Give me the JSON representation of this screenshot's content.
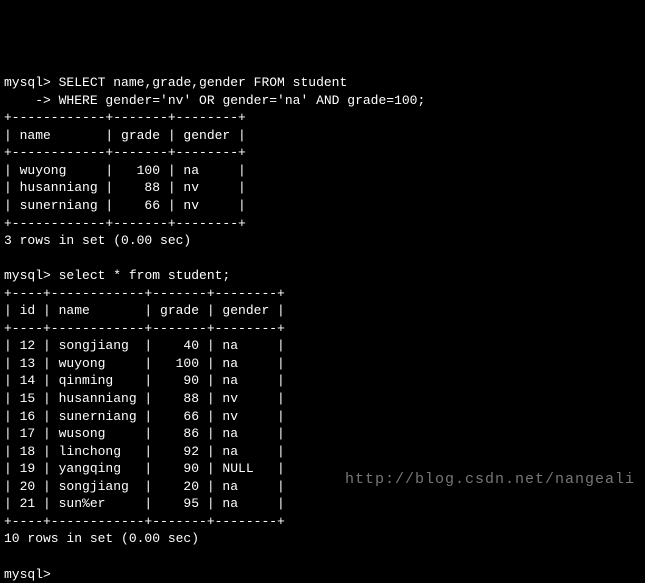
{
  "prompt": "mysql>",
  "continuation": "    ->",
  "query1_line1": "SELECT name,grade,gender FROM student",
  "query1_line2": "WHERE gender='nv' OR gender='na' AND grade=100;",
  "table1": {
    "headers": [
      "name",
      "grade",
      "gender"
    ],
    "sep_top": "+------------+-------+--------+",
    "header_row": "| name       | grade | gender |",
    "sep_mid": "+------------+-------+--------+",
    "rows": [
      "| wuyong     |   100 | na     |",
      "| husanniang |    88 | nv     |",
      "| sunerniang |    66 | nv     |"
    ],
    "sep_bot": "+------------+-------+--------+",
    "footer": "3 rows in set (0.00 sec)"
  },
  "query2": "select * from student;",
  "table2": {
    "headers": [
      "id",
      "name",
      "grade",
      "gender"
    ],
    "sep_top": "+----+------------+-------+--------+",
    "header_row": "| id | name       | grade | gender |",
    "sep_mid": "+----+------------+-------+--------+",
    "rows": [
      "| 12 | songjiang  |    40 | na     |",
      "| 13 | wuyong     |   100 | na     |",
      "| 14 | qinming    |    90 | na     |",
      "| 15 | husanniang |    88 | nv     |",
      "| 16 | sunerniang |    66 | nv     |",
      "| 17 | wusong     |    86 | na     |",
      "| 18 | linchong   |    92 | na     |",
      "| 19 | yangqing   |    90 | NULL   |",
      "| 20 | songjiang  |    20 | na     |",
      "| 21 | sun%er     |    95 | na     |"
    ],
    "sep_bot": "+----+------------+-------+--------+",
    "footer": "10 rows in set (0.00 sec)"
  },
  "final_prompt": "mysql>",
  "watermark": "http://blog.csdn.net/nangeali"
}
